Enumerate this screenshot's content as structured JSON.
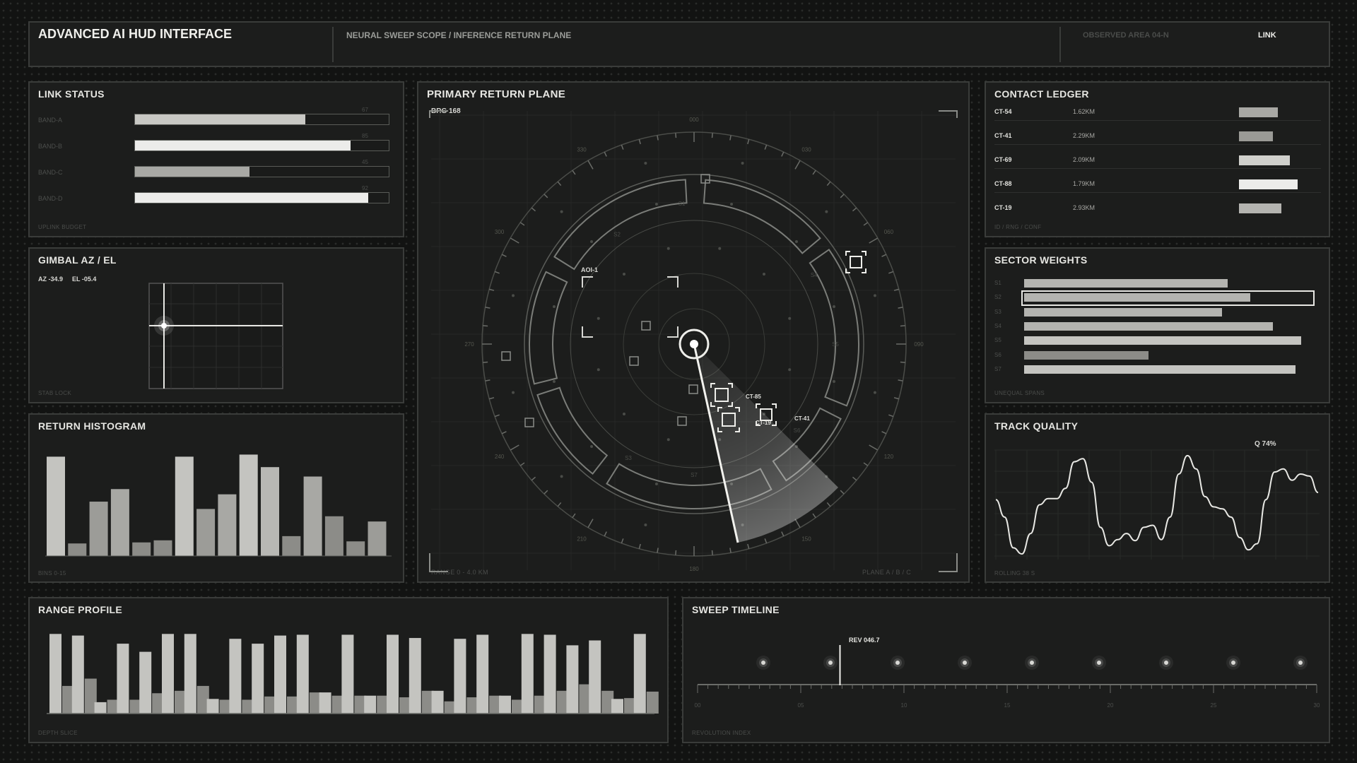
{
  "header": {
    "title": "ADVANCED AI HUD INTERFACE",
    "subtitle": "NEURAL SWEEP SCOPE / INFERENCE RETURN PLANE",
    "observed": "OBSERVED AREA 04-N",
    "link": "LINK"
  },
  "link_status": {
    "title": "LINK STATUS",
    "bands": [
      {
        "label": "BAND-A",
        "value": 67
      },
      {
        "label": "BAND-B",
        "value": 85
      },
      {
        "label": "BAND-C",
        "value": 45
      },
      {
        "label": "BAND-D",
        "value": 92
      }
    ],
    "footer": "UPLINK BUDGET"
  },
  "gimbal": {
    "title": "GIMBAL AZ / EL",
    "az": "AZ -34.9",
    "el": "EL -05.4",
    "footer": "STAB LOCK"
  },
  "histogram": {
    "title": "RETURN HISTOGRAM",
    "footer": "BINS 0-15"
  },
  "primary": {
    "title": "PRIMARY RETURN PLANE",
    "bearing": "BRG 168",
    "range": "RANGE 0 - 4.0 KM",
    "plane": "PLANE A / B / C",
    "aoi": "AOI-1",
    "contacts": [
      "CT-85",
      "CT-19",
      "CT-41"
    ],
    "sectors": [
      "S1",
      "S2",
      "S3",
      "S4",
      "S5",
      "S6",
      "S7"
    ],
    "bearing_labels": [
      "000",
      "030",
      "060",
      "090",
      "120",
      "150",
      "180",
      "210",
      "240",
      "270",
      "300",
      "330"
    ]
  },
  "ledger": {
    "title": "CONTACT LEDGER",
    "rows": [
      {
        "id": "CT-54",
        "range": "1.62KM",
        "conf": 0.55
      },
      {
        "id": "CT-41",
        "range": "2.29KM",
        "conf": 0.48
      },
      {
        "id": "CT-69",
        "range": "2.09KM",
        "conf": 0.72
      },
      {
        "id": "CT-88",
        "range": "1.79KM",
        "conf": 0.83
      },
      {
        "id": "CT-19",
        "range": "2.93KM",
        "conf": 0.6
      }
    ],
    "footer": "ID / RNG / CONF"
  },
  "sector_weights": {
    "title": "SECTOR WEIGHTS",
    "labels": [
      "S1",
      "S2",
      "S3",
      "S4",
      "S5",
      "S6",
      "S7"
    ],
    "values": [
      0.72,
      0.8,
      0.7,
      0.88,
      0.98,
      0.44,
      0.96
    ],
    "footer": "UNEQUAL SPANS"
  },
  "track_quality": {
    "title": "TRACK QUALITY",
    "q": "Q 74%",
    "footer": "ROLLING 38 S"
  },
  "range_profile": {
    "title": "RANGE PROFILE",
    "footer": "DEPTH SLICE"
  },
  "sweep": {
    "title": "SWEEP TIMELINE",
    "marker": "REV 046.7",
    "ticks": [
      "00",
      "05",
      "10",
      "15",
      "20",
      "25",
      "30"
    ],
    "footer": "REVOLUTION INDEX"
  },
  "chart_data": [
    {
      "type": "bar",
      "categories": [
        "0",
        "1",
        "2",
        "3",
        "4",
        "5",
        "6",
        "7",
        "8",
        "9",
        "10",
        "11",
        "12",
        "13",
        "14",
        "15"
      ],
      "values": [
        0.95,
        0.12,
        0.52,
        0.64,
        0.13,
        0.15,
        0.95,
        0.45,
        0.59,
        0.97,
        0.85,
        0.19,
        0.76,
        0.38,
        0.14,
        0.33
      ]
    },
    {
      "type": "line",
      "values": [
        0.55,
        0.38,
        0.08,
        0.02,
        0.22,
        0.5,
        0.56,
        0.56,
        0.66,
        0.92,
        0.95,
        0.72,
        0.28,
        0.1,
        0.16,
        0.22,
        0.15,
        0.28,
        0.3,
        0.16,
        0.38,
        0.8,
        0.98,
        0.85,
        0.58,
        0.48,
        0.46,
        0.38,
        0.18,
        0.06,
        0.12,
        0.55,
        0.82,
        0.85,
        0.74,
        0.8,
        0.78,
        0.62
      ]
    },
    {
      "type": "bar",
      "series": [
        {
          "name": "",
          "values": [
            0.98,
            0.96,
            0.14,
            0.86,
            0.76,
            0.98,
            0.98,
            0.18,
            0.92,
            0.86,
            0.96,
            0.97,
            0.26,
            0.97,
            0.22,
            0.97,
            0.93,
            0.28,
            0.92,
            0.97,
            0.22,
            0.98,
            0.97,
            0.84,
            0.9,
            0.18,
            0.98
          ]
        },
        {
          "name": "",
          "values": [
            0.34,
            0.43,
            0.17,
            0.17,
            0.25,
            0.28,
            0.34,
            0.17,
            0.17,
            0.21,
            0.21,
            0.26,
            0.22,
            0.22,
            0.22,
            0.2,
            0.28,
            0.15,
            0.2,
            0.22,
            0.17,
            0.22,
            0.28,
            0.36,
            0.28,
            0.19,
            0.27
          ]
        }
      ]
    }
  ]
}
